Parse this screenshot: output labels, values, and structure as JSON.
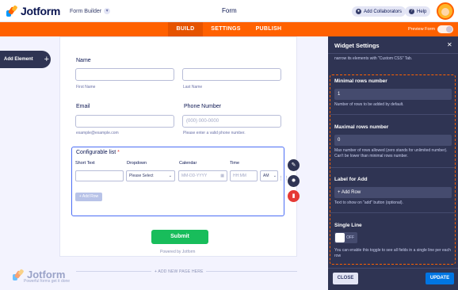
{
  "header": {
    "logo_text": "Jotform",
    "builder_label": "Form Builder",
    "title": "Form",
    "collaborators_label": "Add Collaborators",
    "help_label": "Help"
  },
  "tabs": [
    {
      "label": "BUILD",
      "active": true
    },
    {
      "label": "SETTINGS",
      "active": false
    },
    {
      "label": "PUBLISH",
      "active": false
    }
  ],
  "preview_form_label": "Preview Form",
  "add_element_label": "Add Element",
  "form": {
    "name": {
      "label": "Name",
      "first_sub": "First Name",
      "last_sub": "Last Name"
    },
    "email": {
      "label": "Email",
      "sub": "example@example.com"
    },
    "phone": {
      "label": "Phone Number",
      "placeholder": "(000) 000-0000",
      "sub": "Please enter a valid phone number."
    },
    "config_list": {
      "label": "Configurable list",
      "required_mark": "*",
      "columns": [
        "Short Text",
        "Dropdown",
        "Calendar",
        "Time"
      ],
      "dropdown_value": "Please Select",
      "calendar_placeholder": "MM-DD-YYYY",
      "time_placeholder": "HH:MM",
      "ampm_value": "AM",
      "add_row_label": "+ Add Row"
    },
    "submit_label": "Submit",
    "powered_by": "Powered by Jotform",
    "add_new_page": "+ ADD NEW PAGE HERE"
  },
  "watermark": {
    "logo_text": "Jotform",
    "tagline": "Powerful forms get it done"
  },
  "panel": {
    "title": "Widget Settings",
    "note": "narrow its elements with \"Custom CSS\" Tab.",
    "min_rows": {
      "label": "Minimal rows number",
      "value": "1",
      "desc": "Number of rows to be added by default."
    },
    "max_rows": {
      "label": "Maximal rows number",
      "value": "0",
      "desc": "Max number of rows allowed (zero stands for unlimited number). Can't be lower than minimal rows number."
    },
    "label_for_add": {
      "label": "Label for Add",
      "value": "+ Add Row",
      "desc": "Text to show on \"add\" button (optional)."
    },
    "single_line": {
      "label": "Single Line",
      "toggle_text": "OFF",
      "desc": "You can enable this toggle to see all fields in a single line per each row"
    },
    "close_label": "CLOSE",
    "update_label": "UPDATE"
  },
  "colors": {
    "brand_orange": "#ff6100",
    "panel_bg": "#2f3453",
    "submit_green": "#18bd5b",
    "update_blue": "#0075e3"
  },
  "icons": [
    "magic-wand-icon",
    "gear-icon",
    "trash-icon",
    "close-icon",
    "plus-icon",
    "help-icon",
    "users-icon",
    "calendar-icon",
    "chevron-down-icon"
  ]
}
